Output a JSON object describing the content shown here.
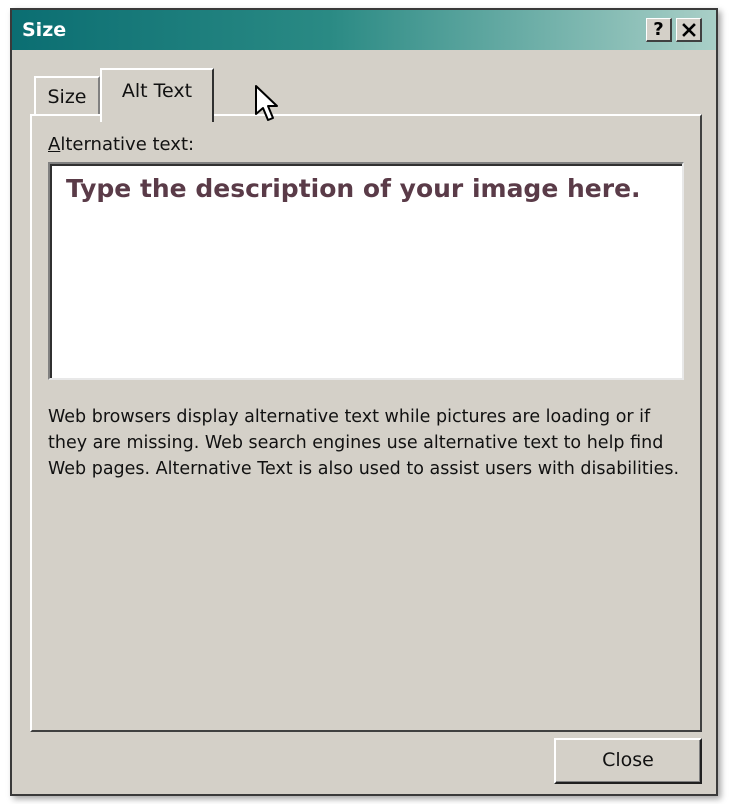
{
  "window": {
    "title": "Size",
    "help_button": "?",
    "close_button": "X"
  },
  "tabs": [
    {
      "label": "Size",
      "active": false
    },
    {
      "label": "Alt Text",
      "active": true
    }
  ],
  "alt_text": {
    "label_accel": "A",
    "label_rest": "lternative text:",
    "placeholder": "Type the description of your image here."
  },
  "description": "Web browsers display alternative text while pictures are loading or if they are missing.  Web search engines use alternative text to help find Web pages.  Alternative Text is also used to assist users with disabilities.",
  "footer": {
    "close_label": "Close"
  },
  "colors": {
    "titlebar_start": "#0b6e72",
    "titlebar_end": "#a9cfc7",
    "dialog_face": "#d4d0c8",
    "placeholder_text": "#5a3b48"
  },
  "icons": {
    "mouse_cursor": "mouse-cursor-icon"
  }
}
